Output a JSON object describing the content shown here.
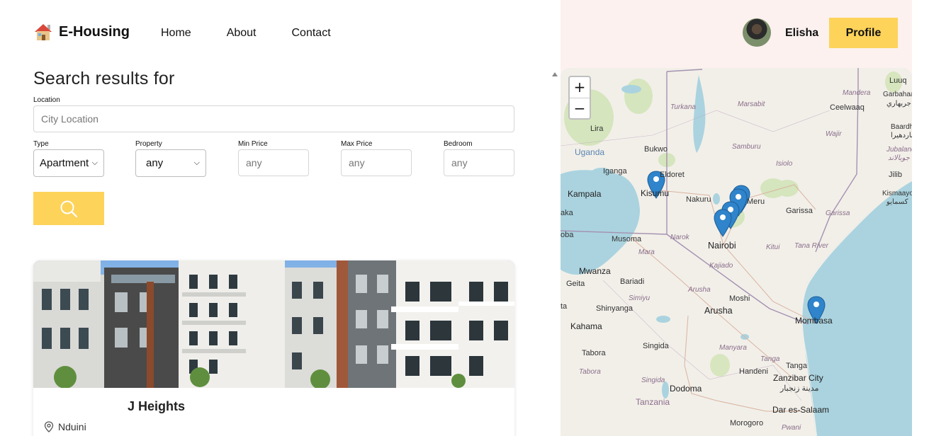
{
  "brand": {
    "name": "E-Housing",
    "logo_icon": "house-icon"
  },
  "nav": {
    "home": "Home",
    "about": "About",
    "contact": "Contact"
  },
  "user": {
    "name": "Elisha",
    "profile_button": "Profile"
  },
  "search": {
    "title": "Search results for",
    "location_label": "Location",
    "location_placeholder": "City Location",
    "type_label": "Type",
    "type_value": "Apartment",
    "property_label": "Property",
    "property_value": "any",
    "min_price_label": "Min Price",
    "min_price_placeholder": "any",
    "max_price_label": "Max Price",
    "max_price_placeholder": "any",
    "bedroom_label": "Bedroom",
    "bedroom_placeholder": "any",
    "search_icon": "search-icon"
  },
  "listing": {
    "title": "J Heights",
    "location": "Nduini",
    "location_icon": "map-pin-icon"
  },
  "map": {
    "zoom_in": "+",
    "zoom_out": "−",
    "labels": {
      "turkana": "Turkana",
      "marsabit": "Marsabit",
      "mandera": "Mandera",
      "luuq": "Luuq",
      "garbahaarey": "Garbahaarey",
      "garbahaarey_ar": "جربهاري",
      "ceelwaaq": "Ceelwaaq",
      "wajir": "Wajir",
      "baardhere": "Baardhere",
      "baardhere_ar": "باردهيرا",
      "jubaland": "Jubaland",
      "jubaland_ar": "جوبالاند",
      "jilib": "Jilib",
      "kismayo": "Kismaayo",
      "kismayo_ar": "كسمايو",
      "lira": "Lira",
      "uganda": "Uganda",
      "bukwo": "Bukwo",
      "samburu": "Samburu",
      "isiolo": "Isiolo",
      "iganga": "Iganga",
      "eldoret": "Eldoret",
      "kampala": "Kampala",
      "kisumu": "Kisumu",
      "nakuru": "Nakuru",
      "meru": "Meru",
      "garissa_town": "Garissa",
      "garissa_region": "Garissa",
      "aka": "aka",
      "oba": "oba",
      "musoma": "Musoma",
      "narok": "Narok",
      "mara": "Mara",
      "nairobi": "Nairobi",
      "kitui": "Kitui",
      "tana_river": "Tana River",
      "kajiado": "Kajiado",
      "mwanza": "Mwanza",
      "geita": "Geita",
      "bariadi": "Bariadi",
      "simiyu": "Simiyu",
      "arusha_region": "Arusha",
      "moshi": "Moshi",
      "to": "ta",
      "shinyanga": "Shinyanga",
      "arusha": "Arusha",
      "kahama": "Kahama",
      "mombasa": "Mombasa",
      "singida_town": "Singida",
      "manyara": "Manyara",
      "tabora_town": "Tabora",
      "tanga_region": "Tanga",
      "tanga": "Tanga",
      "handeni": "Handeni",
      "tabora_region": "Tabora",
      "singida_region": "Singida",
      "zanzibar": "Zanzibar City",
      "zanzibar_ar": "مدينة زنجبار",
      "dodoma": "Dodoma",
      "tanzania": "Tanzania",
      "dar": "Dar es-Salaam",
      "morogoro_town": "Morogoro",
      "pwani": "Pwani"
    }
  }
}
